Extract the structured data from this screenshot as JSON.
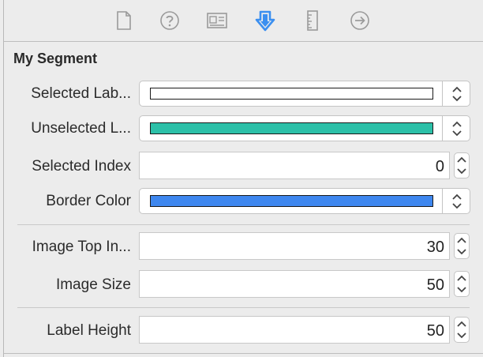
{
  "toolbar": {
    "icons": [
      {
        "name": "file-inspector-icon",
        "active": false
      },
      {
        "name": "quick-help-icon",
        "active": false
      },
      {
        "name": "identity-inspector-icon",
        "active": false
      },
      {
        "name": "attributes-inspector-icon",
        "active": true
      },
      {
        "name": "size-inspector-icon",
        "active": false
      },
      {
        "name": "connections-inspector-icon",
        "active": false
      }
    ],
    "active_color": "#3b8ff0",
    "inactive_color": "#9a9a9a"
  },
  "section": {
    "title": "My Segment"
  },
  "properties": {
    "selected_label_color": {
      "label": "Selected Lab...",
      "color": "#ffffff"
    },
    "unselected_label_color": {
      "label": "Unselected L...",
      "color": "#2cc0a8"
    },
    "selected_index": {
      "label": "Selected Index",
      "value": "0"
    },
    "border_color": {
      "label": "Border Color",
      "color": "#3e87ef"
    },
    "image_top_inset": {
      "label": "Image Top In...",
      "value": "30"
    },
    "image_size": {
      "label": "Image Size",
      "value": "50"
    },
    "label_height": {
      "label": "Label Height",
      "value": "50"
    }
  }
}
